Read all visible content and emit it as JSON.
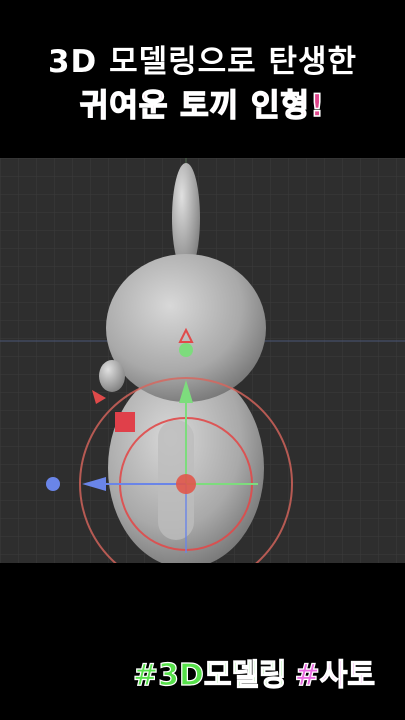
{
  "title": {
    "line1": "3D 모델링으로 탄생한",
    "line2": "귀여운 토끼 인형!"
  },
  "hashtags": {
    "tag1": "#3D모델링",
    "tag2": "#사토"
  },
  "colors": {
    "background": "#000000",
    "viewport_bg": "#2e2e2e",
    "title2_color": "#e0468c",
    "tag1_color": "#56e04a",
    "tag2_color": "#e86ae0",
    "axis_y": "#7ddc7d",
    "axis_x": "#6a85e8",
    "gizmo_ring": "#d8655d"
  },
  "gizmo": {
    "icons": [
      "move-gizmo",
      "rotate-ring",
      "scale-handle"
    ]
  }
}
